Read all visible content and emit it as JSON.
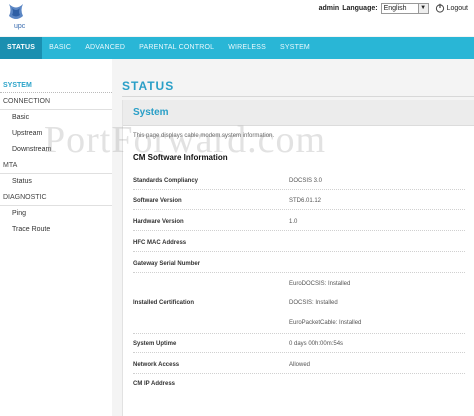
{
  "header": {
    "logo_text": "upc",
    "user": "admin",
    "language_label": "Language:",
    "language_value": "English",
    "logout_label": "Logout"
  },
  "nav": {
    "items": [
      "STATUS",
      "BASIC",
      "ADVANCED",
      "PARENTAL CONTROL",
      "WIRELESS",
      "SYSTEM"
    ],
    "active": "STATUS"
  },
  "sidebar": {
    "items": [
      "SYSTEM",
      "CONNECTION",
      "Basic",
      "Upstream",
      "Downstream",
      "MTA",
      "Status",
      "DIAGNOSTIC",
      "Ping",
      "Trace Route"
    ]
  },
  "page": {
    "title": "STATUS"
  },
  "panel": {
    "title": "System",
    "description": "This page displays cable modem system information.",
    "section_title": "CM Software Information",
    "rows": [
      {
        "label": "Standards Compliancy",
        "value": "DOCSIS 3.0"
      },
      {
        "label": "Software Version",
        "value": "STD6.01.12"
      },
      {
        "label": "Hardware Version",
        "value": "1.0"
      },
      {
        "label": "HFC MAC Address",
        "value": ""
      },
      {
        "label": "Gateway Serial Number",
        "value": ""
      },
      {
        "label": "Installed Certification",
        "value": ""
      },
      {
        "label": "System Uptime",
        "value": "0 days 00h:00m:54s"
      },
      {
        "label": "Network Access",
        "value": "Allowed"
      },
      {
        "label": "CM IP Address",
        "value": ""
      }
    ],
    "certifications": [
      "EuroDOCSIS: Installed",
      "DOCSIS: Installed",
      "EuroPacketCable: Installed"
    ]
  },
  "watermark": "PortForward.com",
  "colors": {
    "accent": "#29b6d6",
    "accent_dark": "#1a8fb0",
    "title_blue": "#2a9fc7"
  }
}
